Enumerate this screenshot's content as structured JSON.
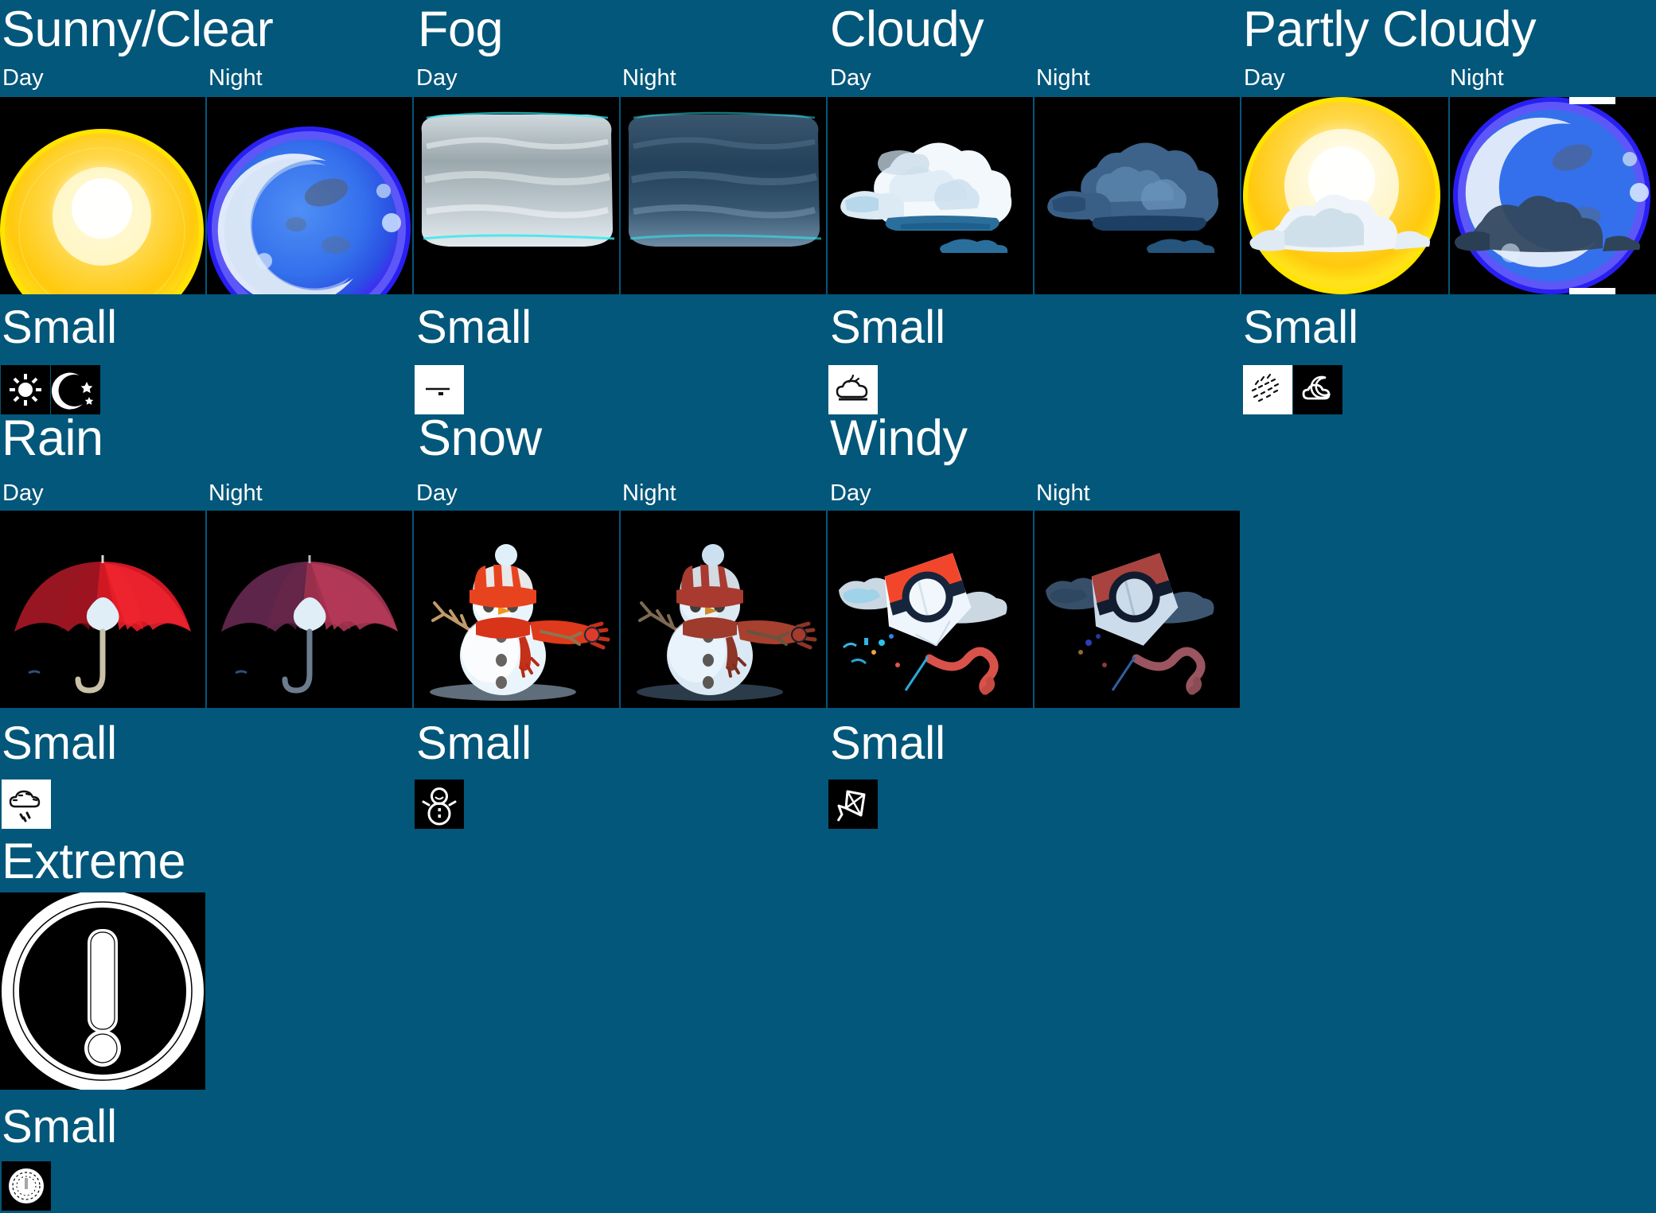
{
  "page": {
    "background_color": "#03577a",
    "tile_background_color": "#000000",
    "text_color": "#ffffff"
  },
  "labels": {
    "day": "Day",
    "night": "Night",
    "small": "Small"
  },
  "groups": [
    {
      "title": "Sunny/Clear",
      "day_label": "Day",
      "night_label": "Night",
      "small_label": "Small",
      "large_icons": [
        {
          "name": "sun-icon",
          "variant": "day"
        },
        {
          "name": "moon-icon",
          "variant": "night"
        }
      ],
      "small_icons": [
        {
          "name": "sun-small-icon",
          "style": "black"
        },
        {
          "name": "moon-stars-small-icon",
          "style": "black"
        }
      ]
    },
    {
      "title": "Fog",
      "day_label": "Day",
      "night_label": "Night",
      "small_label": "Small",
      "large_icons": [
        {
          "name": "fog-bank-icon",
          "variant": "day"
        },
        {
          "name": "fog-bank-icon",
          "variant": "night"
        }
      ],
      "small_icons": [
        {
          "name": "fog-lines-small-icon",
          "style": "white"
        }
      ]
    },
    {
      "title": "Cloudy",
      "day_label": "Day",
      "night_label": "Night",
      "small_label": "Small",
      "large_icons": [
        {
          "name": "cloud-icon",
          "variant": "day"
        },
        {
          "name": "cloud-icon",
          "variant": "night"
        }
      ],
      "small_icons": [
        {
          "name": "cloud-small-icon",
          "style": "white"
        }
      ]
    },
    {
      "title": "Partly Cloudy",
      "day_label": "Day",
      "night_label": "Night",
      "small_label": "Small",
      "large_icons": [
        {
          "name": "sun-cloud-icon",
          "variant": "day"
        },
        {
          "name": "moon-cloud-icon",
          "variant": "night"
        }
      ],
      "small_icons": [
        {
          "name": "sun-cloud-small-icon",
          "style": "white"
        },
        {
          "name": "moon-cloud-small-icon",
          "style": "black"
        }
      ]
    },
    {
      "title": "Rain",
      "day_label": "Day",
      "night_label": "Night",
      "small_label": "Small",
      "large_icons": [
        {
          "name": "umbrella-icon",
          "variant": "day"
        },
        {
          "name": "umbrella-icon",
          "variant": "night"
        }
      ],
      "small_icons": [
        {
          "name": "rain-cloud-small-icon",
          "style": "white"
        }
      ]
    },
    {
      "title": "Snow",
      "day_label": "Day",
      "night_label": "Night",
      "small_label": "Small",
      "large_icons": [
        {
          "name": "snowman-icon",
          "variant": "day"
        },
        {
          "name": "snowman-icon",
          "variant": "night"
        }
      ],
      "small_icons": [
        {
          "name": "snowman-small-icon",
          "style": "black"
        }
      ]
    },
    {
      "title": "Windy",
      "day_label": "Day",
      "night_label": "Night",
      "small_label": "Small",
      "large_icons": [
        {
          "name": "kite-icon",
          "variant": "day"
        },
        {
          "name": "kite-icon",
          "variant": "night"
        }
      ],
      "small_icons": [
        {
          "name": "kite-small-icon",
          "style": "black"
        }
      ]
    },
    {
      "title": "Extreme",
      "small_label": "Small",
      "large_icons": [
        {
          "name": "warning-exclamation-icon",
          "variant": "single"
        }
      ],
      "small_icons": [
        {
          "name": "warning-small-icon",
          "style": "black"
        }
      ]
    }
  ],
  "palette": {
    "sun_yellow": "#ffd21a",
    "sun_core": "#fffbe0",
    "moon_blue": "#2f6ee8",
    "moon_glow": "#5a5af5",
    "cloud_white": "#eef4f8",
    "cloud_dark": "#2e5a80",
    "umbrella_red": "#e01820",
    "umbrella_night": "#9c2a44",
    "kite_red": "#f2462c",
    "kite_night": "#a8433f",
    "scarf_red": "#d8341a"
  }
}
